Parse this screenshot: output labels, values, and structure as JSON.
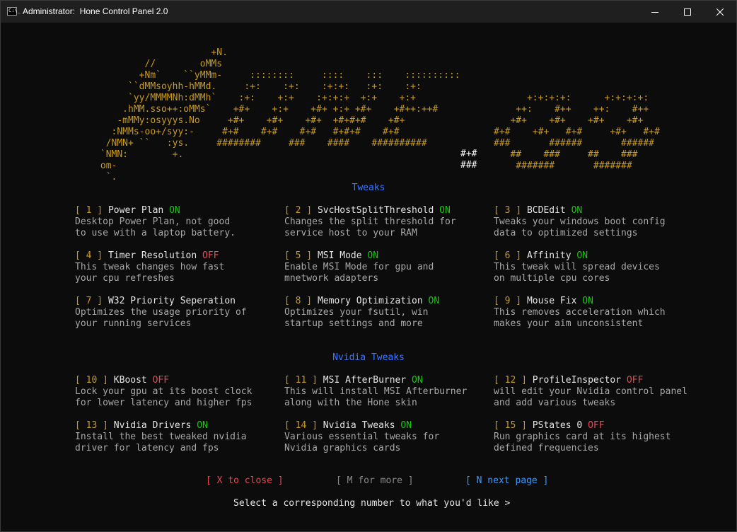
{
  "window": {
    "title": "Administrator:  Hone Control Panel 2.0",
    "icon_name": "console-icon",
    "icon_text": "C:\\_"
  },
  "ascii_art": {
    "logo_left": [
      "                                      +N.",
      "                          //        oMMs",
      "                         +Nm`    ``yMMm-     ::::::::     ::::    :::    ::::::::::",
      "                       ``dMMsoyhh-hMMd.     :+:    :+:    :+:+:   :+:    :+:",
      "                       `yy/MMMMNh:dMMh`    :+:    +:+    :+:+:+  +:+    +:+",
      "                      .hMM.sso++:oMMs`    +#+    +:+    +#+ +:+ +#+    +#++:++#",
      "                     -mMMy:osyyys.No     +#+    +#+    +#+  +#+#+#    +#+",
      "                    :NMMs-oo+/syy:-     #+#    #+#    #+#   #+#+#    #+#",
      "                   /NMN+ ``   :ys.     ########     ###    ####    ##########",
      "                  `NMN:        +.",
      "                  om-",
      "                   `."
    ],
    "logo_right": [
      "",
      "",
      "",
      "",
      "      +:+:+:+:      +:+:+:+:",
      "    ++:    #++    ++:    #++",
      "   +#+    +#+    +#+    +#+",
      "#+#    +#+   #+#     +#+   #+#",
      "###       ######       ######",
      "   ##    ###     ##    ###",
      "    #######       #######",
      ""
    ]
  },
  "sections": [
    {
      "title": "Tweaks",
      "items": [
        {
          "num": "1",
          "name": "Power Plan",
          "status": "ON",
          "desc1": "Desktop Power Plan, not good",
          "desc2": "to use with a laptop battery."
        },
        {
          "num": "2",
          "name": "SvcHostSplitThreshold",
          "status": "ON",
          "desc1": "Changes the split threshold for",
          "desc2": "service host to your RAM"
        },
        {
          "num": "3",
          "name": "BCDEdit",
          "status": "ON",
          "desc1": "Tweaks your windows boot config",
          "desc2": "data to optimized settings"
        },
        {
          "num": "4",
          "name": "Timer Resolution",
          "status": "OFF",
          "desc1": "This tweak changes how fast",
          "desc2": "your cpu refreshes"
        },
        {
          "num": "5",
          "name": "MSI Mode",
          "status": "ON",
          "desc1": "Enable MSI Mode for gpu and",
          "desc2": "mnetwork adapters"
        },
        {
          "num": "6",
          "name": "Affinity",
          "status": "ON",
          "desc1": "This tweak will spread devices",
          "desc2": "on multiple cpu cores"
        },
        {
          "num": "7",
          "name": "W32 Priority Seperation",
          "status": "",
          "desc1": "Optimizes the usage priority of",
          "desc2": "your running services"
        },
        {
          "num": "8",
          "name": "Memory Optimization",
          "status": "ON",
          "desc1": "Optimizes your fsutil, win",
          "desc2": "startup settings and more"
        },
        {
          "num": "9",
          "name": "Mouse Fix",
          "status": "ON",
          "desc1": "This removes acceleration which",
          "desc2": "makes your aim unconsistent"
        }
      ]
    },
    {
      "title": "Nvidia Tweaks",
      "items": [
        {
          "num": "10",
          "name": "KBoost",
          "status": "OFF",
          "desc1": "Lock your gpu at its boost clock",
          "desc2": "for lower latency and higher fps"
        },
        {
          "num": "11",
          "name": "MSI AfterBurner",
          "status": "ON",
          "desc1": "This will install MSI Afterburner",
          "desc2": "along with the Hone skin"
        },
        {
          "num": "12",
          "name": "ProfileInspector",
          "status": "OFF",
          "desc1": "will edit your Nvidia control panel",
          "desc2": "and add various tweaks"
        },
        {
          "num": "13",
          "name": "Nvidia Drivers",
          "status": "ON",
          "desc1": "Install the best tweaked nvidia",
          "desc2": "driver for latency and fps"
        },
        {
          "num": "14",
          "name": "Nvidia Tweaks",
          "status": "ON",
          "desc1": "Various essential tweaks for",
          "desc2": "Nvidia graphics cards"
        },
        {
          "num": "15",
          "name": "PStates 0",
          "status": "OFF",
          "desc1": "Run graphics card at its highest",
          "desc2": "defined frequencies"
        }
      ]
    }
  ],
  "footer": {
    "close": "[ X to close ]",
    "more": "[ M for more ]",
    "next": "[ N next page ]",
    "prompt": "Select a corresponding number to what you'd like >"
  },
  "colors": {
    "on": "#16c60c",
    "off": "#e74856",
    "accent_yellow": "#c99a1b",
    "section_blue": "#3b78ff",
    "next_blue": "#3b9cff"
  }
}
